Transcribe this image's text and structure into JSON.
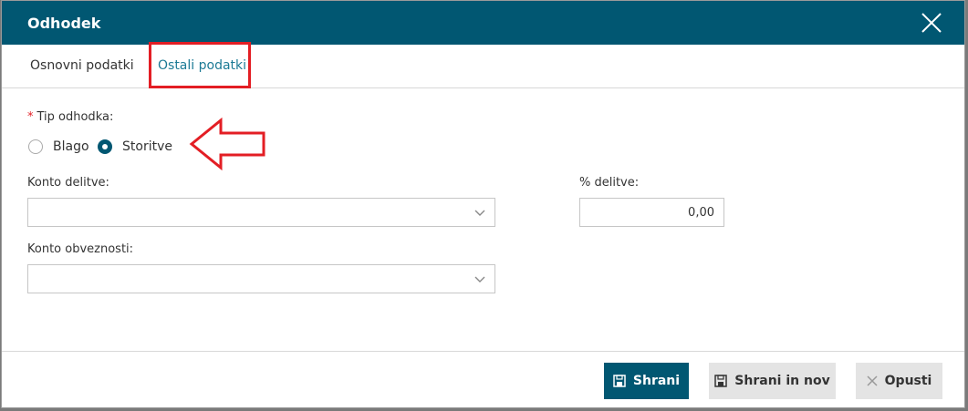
{
  "dialog": {
    "title": "Odhodek"
  },
  "tabs": [
    {
      "label": "Osnovni podatki",
      "active": false
    },
    {
      "label": "Ostali podatki",
      "active": true
    }
  ],
  "form": {
    "tip_odhodka": {
      "required_mark": "*",
      "label": "Tip odhodka:",
      "options": [
        {
          "label": "Blago",
          "checked": false
        },
        {
          "label": "Storitve",
          "checked": true
        }
      ]
    },
    "konto_delitve": {
      "label": "Konto delitve:",
      "value": ""
    },
    "procent_delitve": {
      "label": "% delitve:",
      "value": "0,00"
    },
    "konto_obveznosti": {
      "label": "Konto obveznosti:",
      "value": ""
    }
  },
  "buttons": {
    "save": "Shrani",
    "save_new": "Shrani in nov",
    "cancel": "Opusti"
  },
  "colors": {
    "header": "#015772",
    "annotation": "#e31e24",
    "active_tab": "#1c7a95"
  },
  "icons": {
    "close": "close-icon",
    "save": "save-icon",
    "cancel": "x-icon",
    "dropdown": "chevron-down-icon",
    "annotation": "arrow-left-icon"
  }
}
